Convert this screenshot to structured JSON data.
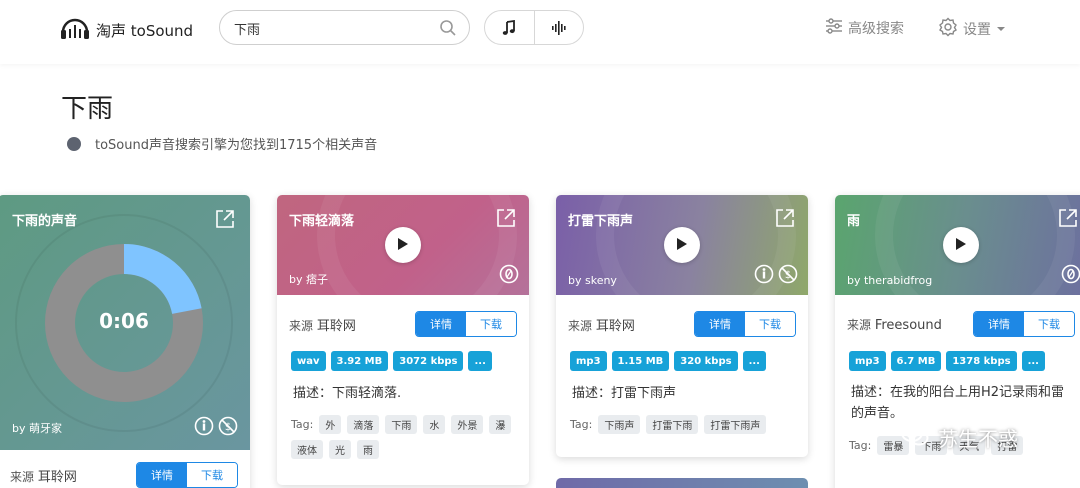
{
  "header": {
    "logo_text": "淘声 toSound",
    "search_value": "下雨",
    "advanced_search": "高级搜索",
    "settings": "设置"
  },
  "page": {
    "title": "下雨",
    "result_text": "toSound声音搜索引擎为您找到1715个相关声音"
  },
  "cards": [
    {
      "title": "下雨的声音",
      "author": "by 萌牙家",
      "timer": "0:06",
      "progress": 0.22,
      "source_label": "来源",
      "source": "耳聆网",
      "detail": "详情",
      "download": "下载"
    },
    {
      "title": "下雨轻滴落",
      "author": "by 痞子",
      "source_label": "来源",
      "source": "耳聆网",
      "detail": "详情",
      "download": "下载",
      "badges": [
        "wav",
        "3.92 MB",
        "3072 kbps",
        "..."
      ],
      "description": "描述：下雨轻滴落.",
      "tag_label": "Tag:",
      "tags": [
        "外",
        "滴落",
        "下雨",
        "水",
        "外景",
        "瀑",
        "液体",
        "光",
        "雨"
      ]
    },
    {
      "title": "打雷下雨声",
      "author": "by skeny",
      "source_label": "来源",
      "source": "耳聆网",
      "detail": "详情",
      "download": "下载",
      "badges": [
        "mp3",
        "1.15 MB",
        "320 kbps",
        "..."
      ],
      "description": "描述：打雷下雨声",
      "tag_label": "Tag:",
      "tags": [
        "下雨声",
        "打雷下雨",
        "打雷下雨声"
      ]
    },
    {
      "title": "雨",
      "author": "by therabidfrog",
      "source_label": "来源",
      "source": "Freesound",
      "detail": "详情",
      "download": "下载",
      "badges": [
        "mp3",
        "6.7 MB",
        "1378 kbps",
        "..."
      ],
      "description": "描述：在我的阳台上用H2记录雨和雷的声音。",
      "tag_label": "Tag:",
      "tags": [
        "雷暴",
        "下雨",
        "天气",
        "打雷"
      ]
    }
  ],
  "watermark": "苏生不惑"
}
